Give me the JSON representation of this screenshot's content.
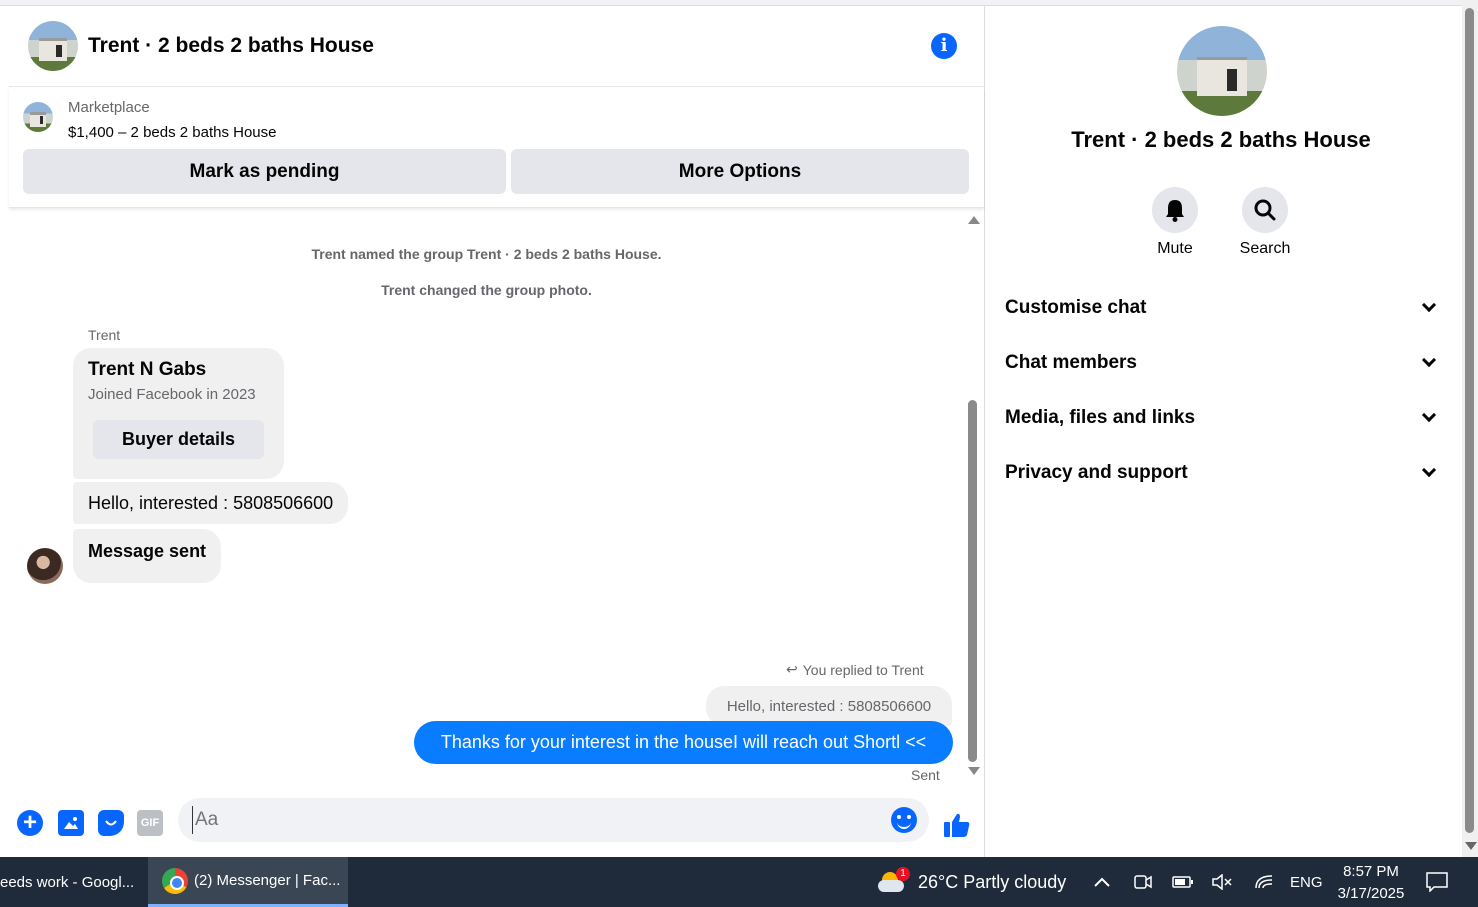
{
  "chat": {
    "title": "Trent · 2 beds 2 baths House",
    "marketplace": {
      "label": "Marketplace",
      "price": "$1,400 – 2 beds 2 baths House",
      "mark_pending": "Mark as pending",
      "more_options": "More Options"
    },
    "system_messages": [
      "Trent named the group Trent · 2 beds 2 baths House.",
      "Trent changed the group photo."
    ],
    "sender_name": "Trent",
    "card": {
      "name": "Trent N Gabs",
      "subtitle": "Joined Facebook in 2023",
      "button": "Buyer details"
    },
    "incoming": [
      "Hello, interested : 5808506600",
      "Message sent"
    ],
    "replied_label": "You replied to Trent",
    "quoted": "Hello, interested : 5808506600",
    "outgoing": "Thanks for your interest in the houseI will reach out Shortl <<",
    "status": "Sent",
    "composer": {
      "placeholder": "Aa",
      "gif": "GIF"
    }
  },
  "panel": {
    "title": "Trent · 2 beds 2 baths House",
    "mute": "Mute",
    "search": "Search",
    "sections": [
      "Customise chat",
      "Chat members",
      "Media, files and links",
      "Privacy and support"
    ]
  },
  "taskbar": {
    "task1": "eeds work - Googl...",
    "task2": "(2) Messenger | Fac...",
    "weather_badge": "1",
    "weather": "26°C  Partly cloudy",
    "lang": "ENG",
    "time": "8:57 PM",
    "date": "3/17/2025"
  },
  "colors": {
    "accent": "#0866ff",
    "outgoing_bubble": "#0a7cff",
    "taskbar": "#1f2b3a"
  }
}
